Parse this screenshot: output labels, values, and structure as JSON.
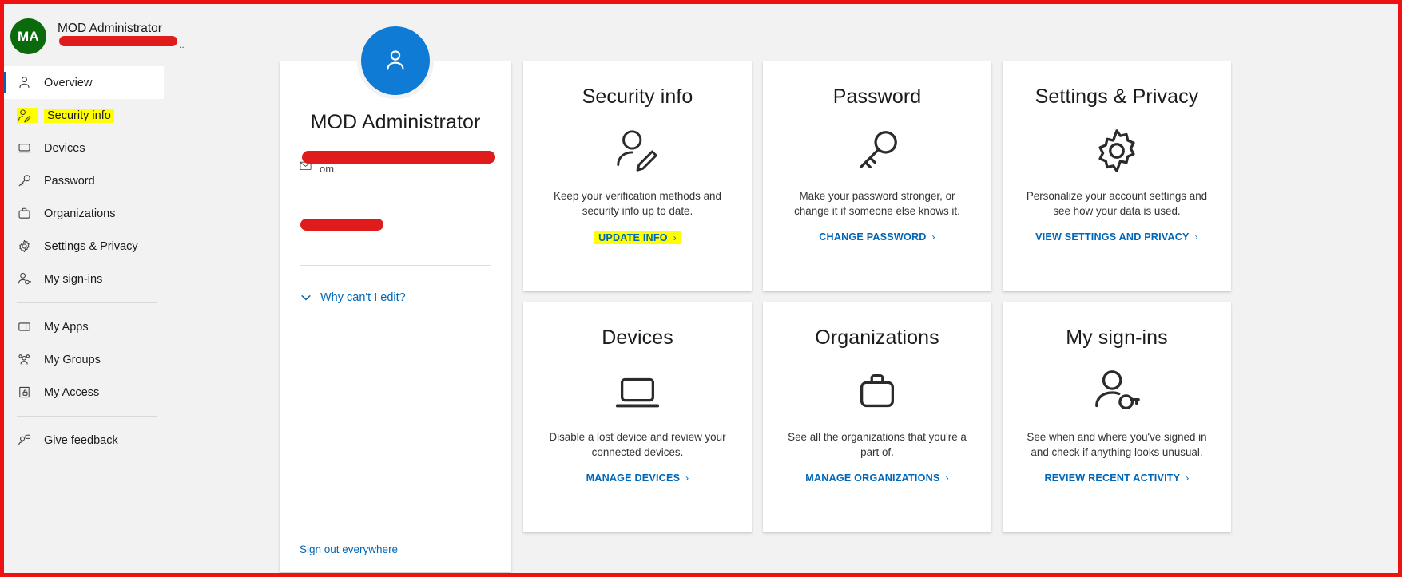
{
  "account_header": {
    "avatar_initials": "MA",
    "avatar_color": "#0b6a0b",
    "name": "MOD Administrator",
    "email_redacted_dots": ".."
  },
  "sidebar": {
    "items": [
      {
        "label": "Overview",
        "icon": "person-icon",
        "selected": true,
        "highlighted": false
      },
      {
        "label": "Security info",
        "icon": "person-edit-icon",
        "selected": false,
        "highlighted": true
      },
      {
        "label": "Devices",
        "icon": "laptop-icon",
        "selected": false,
        "highlighted": false
      },
      {
        "label": "Password",
        "icon": "key-icon",
        "selected": false,
        "highlighted": false
      },
      {
        "label": "Organizations",
        "icon": "briefcase-icon",
        "selected": false,
        "highlighted": false
      },
      {
        "label": "Settings & Privacy",
        "icon": "gear-icon",
        "selected": false,
        "highlighted": false
      },
      {
        "label": "My sign-ins",
        "icon": "person-key-icon",
        "selected": false,
        "highlighted": false
      },
      {
        "label": "My Apps",
        "icon": "apps-icon",
        "selected": false,
        "highlighted": false
      },
      {
        "label": "My Groups",
        "icon": "groups-icon",
        "selected": false,
        "highlighted": false
      },
      {
        "label": "My Access",
        "icon": "access-lock-icon",
        "selected": false,
        "highlighted": false
      },
      {
        "label": "Give feedback",
        "icon": "feedback-icon",
        "selected": false,
        "highlighted": false
      }
    ]
  },
  "profile": {
    "avatar_color": "#0f7bd4",
    "avatar_icon": "person-icon",
    "name": "MOD Administrator",
    "email_visible_fragment": "om",
    "why_cant_i_edit": "Why can't I edit?",
    "sign_out_everywhere": "Sign out everywhere"
  },
  "tiles": [
    {
      "title": "Security info",
      "icon": "person-edit-icon",
      "description": "Keep your verification methods and security info up to date.",
      "link_label": "UPDATE INFO",
      "link_arrow": "›",
      "highlighted": true
    },
    {
      "title": "Password",
      "icon": "key-icon",
      "description": "Make your password stronger, or change it if someone else knows it.",
      "link_label": "CHANGE PASSWORD",
      "link_arrow": "›",
      "highlighted": false
    },
    {
      "title": "Settings & Privacy",
      "icon": "gear-icon",
      "description": "Personalize your account settings and see how your data is used.",
      "link_label": "VIEW SETTINGS AND PRIVACY",
      "link_arrow": "›",
      "highlighted": false
    },
    {
      "title": "Devices",
      "icon": "laptop-icon",
      "description": "Disable a lost device and review your connected devices.",
      "link_label": "MANAGE DEVICES",
      "link_arrow": "›",
      "highlighted": false
    },
    {
      "title": "Organizations",
      "icon": "briefcase-icon",
      "description": "See all the organizations that you're a part of.",
      "link_label": "MANAGE ORGANIZATIONS",
      "link_arrow": "›",
      "highlighted": false
    },
    {
      "title": "My sign-ins",
      "icon": "person-key-icon",
      "description": "See when and where you've signed in and check if anything looks unusual.",
      "link_label": "REVIEW RECENT ACTIVITY",
      "link_arrow": "›",
      "highlighted": false
    }
  ],
  "colors": {
    "link_blue": "#0067b8",
    "highlight_yellow": "#ffff00",
    "redaction_red": "#e01b1b",
    "annotation_border": "#ee1111"
  }
}
